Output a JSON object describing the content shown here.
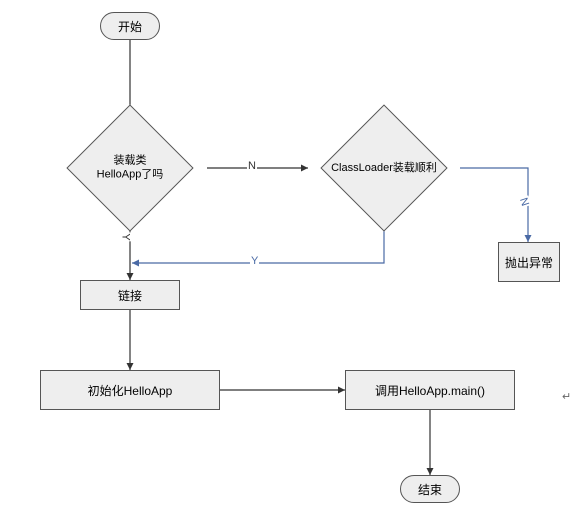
{
  "flowchart": {
    "nodes": {
      "start": {
        "label": "开始",
        "type": "terminator"
      },
      "decision_loaded": {
        "label_line1": "装载类",
        "label_line2": "HelloApp了吗",
        "type": "decision"
      },
      "decision_classloader": {
        "label": "ClassLoader装载顺利",
        "type": "decision"
      },
      "throw_exception": {
        "label": "抛出异常",
        "type": "process"
      },
      "link": {
        "label": "链接",
        "type": "process"
      },
      "init": {
        "label": "初始化HelloApp",
        "type": "process"
      },
      "call_main": {
        "label": "调用HelloApp.main()",
        "type": "process"
      },
      "end": {
        "label": "结束",
        "type": "terminator"
      }
    },
    "edges": {
      "loaded_no": "N",
      "loaded_yes": "Y",
      "classloader_no": "N",
      "classloader_yes": "Y"
    }
  },
  "footnote": "↵"
}
